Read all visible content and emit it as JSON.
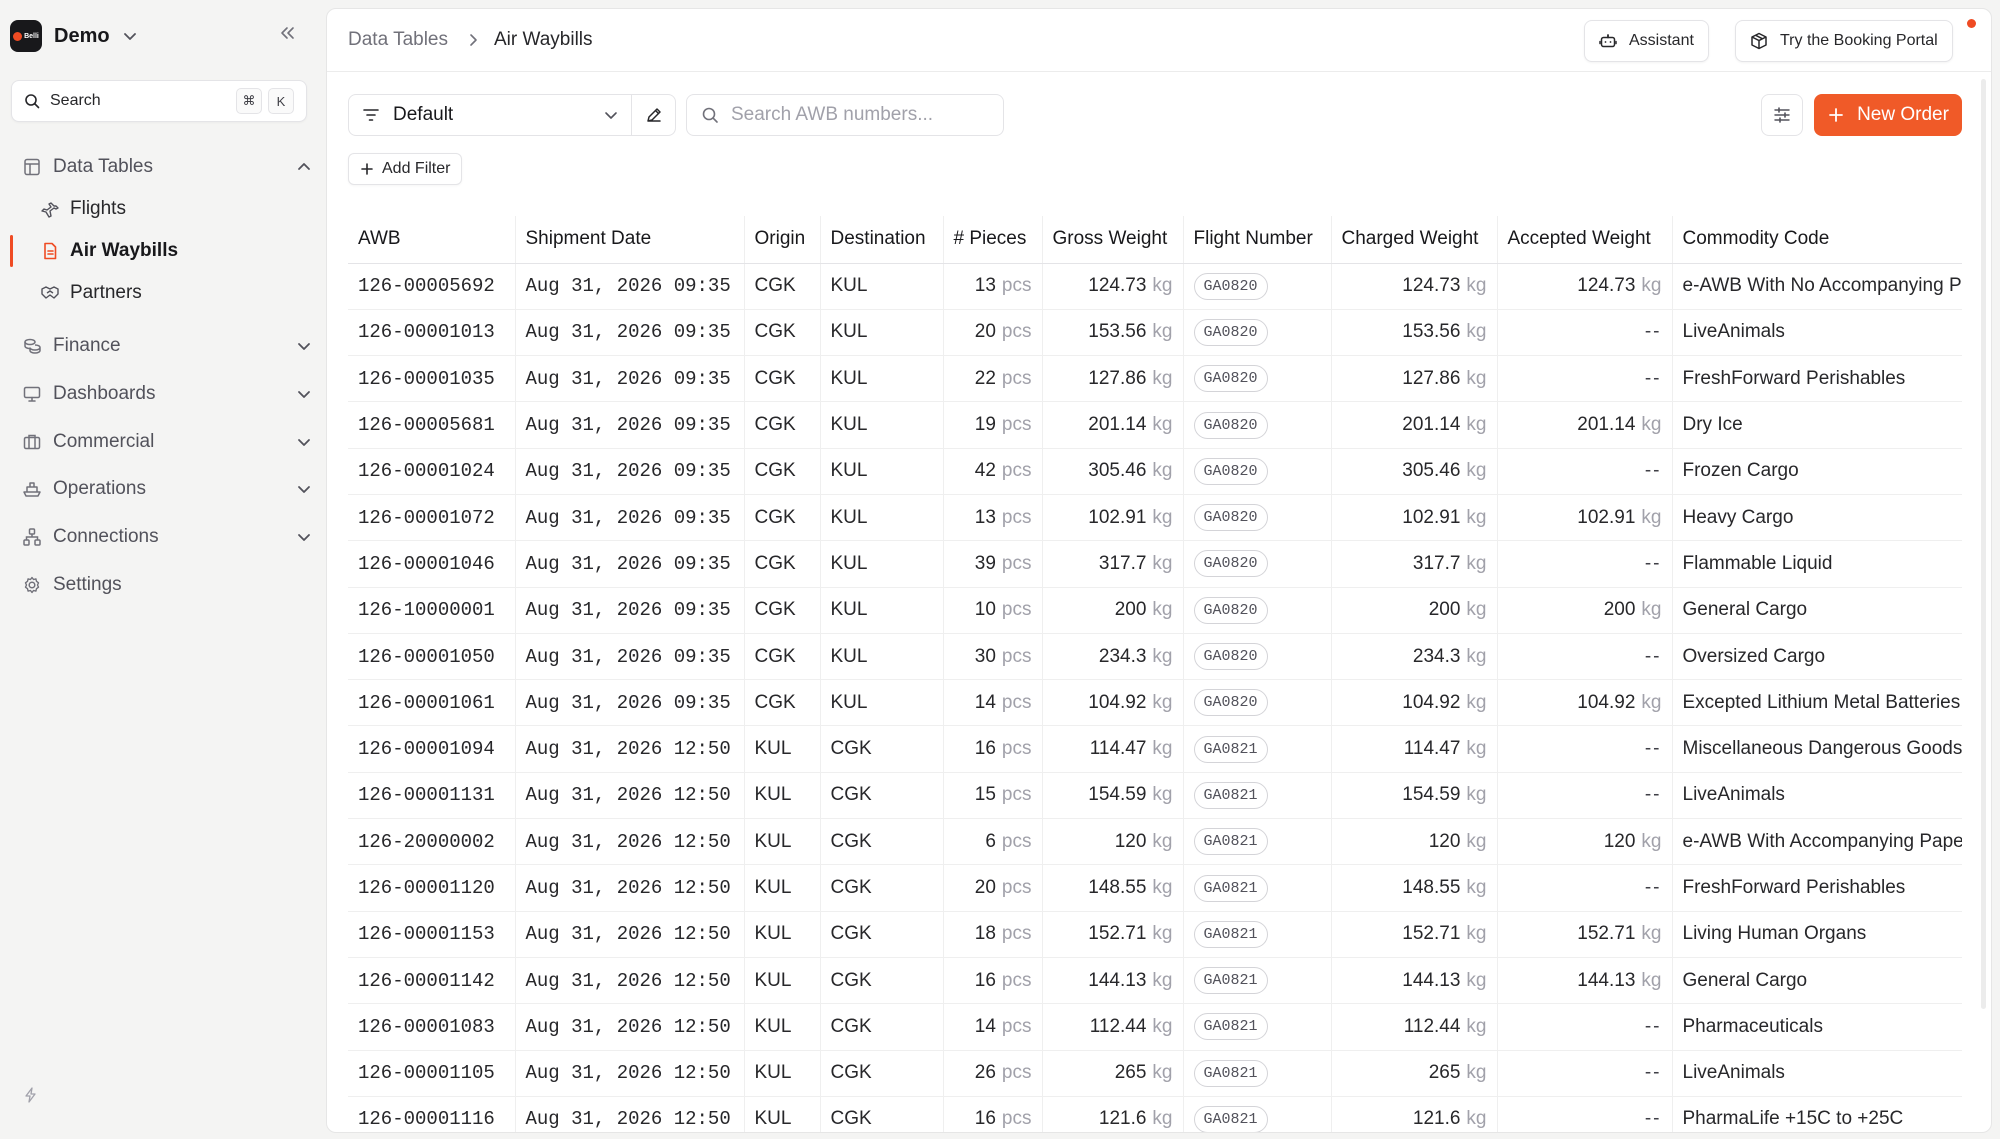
{
  "workspace": {
    "logo_text": "Belli",
    "name": "Demo"
  },
  "search": {
    "label": "Search",
    "shortcut_mod": "⌘",
    "shortcut_key": "K"
  },
  "nav": {
    "data_tables": "Data Tables",
    "flights": "Flights",
    "air_waybills": "Air Waybills",
    "partners": "Partners",
    "finance": "Finance",
    "dashboards": "Dashboards",
    "commercial": "Commercial",
    "operations": "Operations",
    "connections": "Connections",
    "settings": "Settings"
  },
  "breadcrumb": {
    "parent": "Data Tables",
    "current": "Air Waybills"
  },
  "header": {
    "assistant_label": "Assistant",
    "booking_label": "Try the Booking Portal"
  },
  "toolbar": {
    "view_name": "Default",
    "search_placeholder": "Search AWB numbers...",
    "new_order_label": "New Order",
    "add_filter_label": "Add Filter"
  },
  "colors": {
    "accent": "#f05a28",
    "notification": "#ef4b23"
  },
  "table": {
    "unit_pcs": "pcs",
    "unit_kg": "kg",
    "columns": [
      "AWB",
      "Shipment Date",
      "Origin",
      "Destination",
      "# Pieces",
      "Gross Weight",
      "Flight Number",
      "Charged Weight",
      "Accepted Weight",
      "Commodity Code"
    ],
    "rows": [
      {
        "awb": "126-00005692",
        "date": "Aug 31, 2026 09:35",
        "origin": "CGK",
        "dest": "KUL",
        "pieces": "13",
        "gross": "124.73",
        "flight": "GA0820",
        "charged": "124.73",
        "accepted": "124.73",
        "commodity": "e-AWB With No Accompanying Paper"
      },
      {
        "awb": "126-00001013",
        "date": "Aug 31, 2026 09:35",
        "origin": "CGK",
        "dest": "KUL",
        "pieces": "20",
        "gross": "153.56",
        "flight": "GA0820",
        "charged": "153.56",
        "accepted": "",
        "commodity": "LiveAnimals"
      },
      {
        "awb": "126-00001035",
        "date": "Aug 31, 2026 09:35",
        "origin": "CGK",
        "dest": "KUL",
        "pieces": "22",
        "gross": "127.86",
        "flight": "GA0820",
        "charged": "127.86",
        "accepted": "",
        "commodity": "FreshForward Perishables"
      },
      {
        "awb": "126-00005681",
        "date": "Aug 31, 2026 09:35",
        "origin": "CGK",
        "dest": "KUL",
        "pieces": "19",
        "gross": "201.14",
        "flight": "GA0820",
        "charged": "201.14",
        "accepted": "201.14",
        "commodity": "Dry Ice"
      },
      {
        "awb": "126-00001024",
        "date": "Aug 31, 2026 09:35",
        "origin": "CGK",
        "dest": "KUL",
        "pieces": "42",
        "gross": "305.46",
        "flight": "GA0820",
        "charged": "305.46",
        "accepted": "",
        "commodity": "Frozen Cargo"
      },
      {
        "awb": "126-00001072",
        "date": "Aug 31, 2026 09:35",
        "origin": "CGK",
        "dest": "KUL",
        "pieces": "13",
        "gross": "102.91",
        "flight": "GA0820",
        "charged": "102.91",
        "accepted": "102.91",
        "commodity": "Heavy Cargo"
      },
      {
        "awb": "126-00001046",
        "date": "Aug 31, 2026 09:35",
        "origin": "CGK",
        "dest": "KUL",
        "pieces": "39",
        "gross": "317.7",
        "flight": "GA0820",
        "charged": "317.7",
        "accepted": "",
        "commodity": "Flammable Liquid"
      },
      {
        "awb": "126-10000001",
        "date": "Aug 31, 2026 09:35",
        "origin": "CGK",
        "dest": "KUL",
        "pieces": "10",
        "gross": "200",
        "flight": "GA0820",
        "charged": "200",
        "accepted": "200",
        "commodity": "General Cargo"
      },
      {
        "awb": "126-00001050",
        "date": "Aug 31, 2026 09:35",
        "origin": "CGK",
        "dest": "KUL",
        "pieces": "30",
        "gross": "234.3",
        "flight": "GA0820",
        "charged": "234.3",
        "accepted": "",
        "commodity": "Oversized Cargo"
      },
      {
        "awb": "126-00001061",
        "date": "Aug 31, 2026 09:35",
        "origin": "CGK",
        "dest": "KUL",
        "pieces": "14",
        "gross": "104.92",
        "flight": "GA0820",
        "charged": "104.92",
        "accepted": "104.92",
        "commodity": "Excepted Lithium Metal Batteries"
      },
      {
        "awb": "126-00001094",
        "date": "Aug 31, 2026 12:50",
        "origin": "KUL",
        "dest": "CGK",
        "pieces": "16",
        "gross": "114.47",
        "flight": "GA0821",
        "charged": "114.47",
        "accepted": "",
        "commodity": "Miscellaneous Dangerous Goods"
      },
      {
        "awb": "126-00001131",
        "date": "Aug 31, 2026 12:50",
        "origin": "KUL",
        "dest": "CGK",
        "pieces": "15",
        "gross": "154.59",
        "flight": "GA0821",
        "charged": "154.59",
        "accepted": "",
        "commodity": "LiveAnimals"
      },
      {
        "awb": "126-20000002",
        "date": "Aug 31, 2026 12:50",
        "origin": "KUL",
        "dest": "CGK",
        "pieces": "6",
        "gross": "120",
        "flight": "GA0821",
        "charged": "120",
        "accepted": "120",
        "commodity": "e-AWB With Accompanying Paper"
      },
      {
        "awb": "126-00001120",
        "date": "Aug 31, 2026 12:50",
        "origin": "KUL",
        "dest": "CGK",
        "pieces": "20",
        "gross": "148.55",
        "flight": "GA0821",
        "charged": "148.55",
        "accepted": "",
        "commodity": "FreshForward Perishables"
      },
      {
        "awb": "126-00001153",
        "date": "Aug 31, 2026 12:50",
        "origin": "KUL",
        "dest": "CGK",
        "pieces": "18",
        "gross": "152.71",
        "flight": "GA0821",
        "charged": "152.71",
        "accepted": "152.71",
        "commodity": "Living Human Organs"
      },
      {
        "awb": "126-00001142",
        "date": "Aug 31, 2026 12:50",
        "origin": "KUL",
        "dest": "CGK",
        "pieces": "16",
        "gross": "144.13",
        "flight": "GA0821",
        "charged": "144.13",
        "accepted": "144.13",
        "commodity": "General Cargo"
      },
      {
        "awb": "126-00001083",
        "date": "Aug 31, 2026 12:50",
        "origin": "KUL",
        "dest": "CGK",
        "pieces": "14",
        "gross": "112.44",
        "flight": "GA0821",
        "charged": "112.44",
        "accepted": "",
        "commodity": "Pharmaceuticals"
      },
      {
        "awb": "126-00001105",
        "date": "Aug 31, 2026 12:50",
        "origin": "KUL",
        "dest": "CGK",
        "pieces": "26",
        "gross": "265",
        "flight": "GA0821",
        "charged": "265",
        "accepted": "",
        "commodity": "LiveAnimals"
      },
      {
        "awb": "126-00001116",
        "date": "Aug 31, 2026 12:50",
        "origin": "KUL",
        "dest": "CGK",
        "pieces": "16",
        "gross": "121.6",
        "flight": "GA0821",
        "charged": "121.6",
        "accepted": "",
        "commodity": "PharmaLife +15C to +25C"
      }
    ]
  }
}
